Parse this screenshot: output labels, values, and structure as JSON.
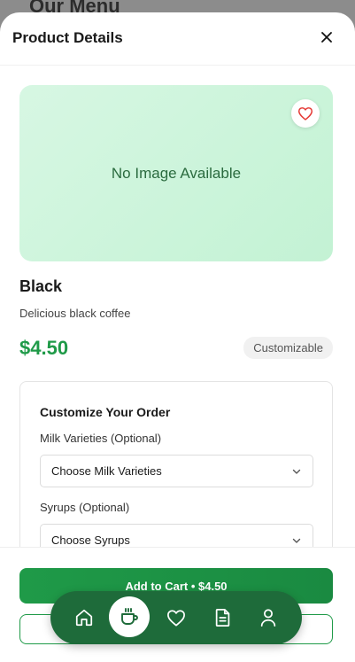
{
  "background": {
    "title": "Our Menu"
  },
  "sheet": {
    "title": "Product Details",
    "close_icon": "close-icon"
  },
  "product": {
    "image_placeholder": "No Image Available",
    "name": "Black",
    "description": "Delicious black coffee",
    "price": "$4.50",
    "badge": "Customizable"
  },
  "customize": {
    "title": "Customize Your Order",
    "fields": [
      {
        "label": "Milk Varieties (Optional)",
        "value": "Choose Milk Varieties"
      },
      {
        "label": "Syrups (Optional)",
        "value": "Choose Syrups"
      }
    ]
  },
  "footer": {
    "add_to_cart_label": "Add to Cart • $4.50"
  },
  "bottom_nav": {
    "items": [
      "home-icon",
      "coffee-icon",
      "heart-icon",
      "orders-icon",
      "profile-icon"
    ],
    "active": "coffee-icon"
  },
  "colors": {
    "accent": "#1f9a48",
    "nav_bg": "#1e6b3a",
    "image_bg": "#c3f2d4",
    "heart": "#e53935"
  }
}
